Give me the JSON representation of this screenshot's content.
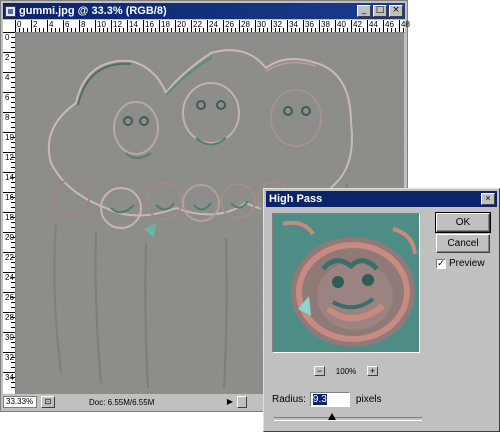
{
  "document_window": {
    "title": "gummi.jpg @ 33.3% (RGB/8)",
    "buttons": {
      "minimize": "_",
      "maximize": "□",
      "close": "×"
    },
    "ruler_h_labels": [
      "0",
      "2",
      "4",
      "6",
      "8",
      "10",
      "12",
      "14",
      "16",
      "18",
      "20",
      "22",
      "24",
      "26",
      "28",
      "30",
      "32",
      "34",
      "36",
      "38",
      "40",
      "42",
      "44",
      "46",
      "48"
    ],
    "ruler_v_labels": [
      "0",
      "2",
      "4",
      "6",
      "8",
      "10",
      "12",
      "14",
      "16",
      "18",
      "20",
      "22",
      "24",
      "26",
      "28",
      "30",
      "32",
      "34"
    ],
    "status": {
      "zoom": "33.33%",
      "doc_size": "Doc: 6.55M/6.55M",
      "arrow": "▶"
    }
  },
  "dialog": {
    "title": "High Pass",
    "close": "×",
    "ok_label": "OK",
    "cancel_label": "Cancel",
    "preview_label": "Preview",
    "preview_checked": true,
    "zoom_out": "−",
    "zoom_in": "+",
    "zoom_level": "100%",
    "radius_label": "Radius:",
    "radius_value": "9.3",
    "radius_unit": "pixels"
  },
  "colors": {
    "title_bar": "#0a246a",
    "chrome": "#c0c0c0",
    "canvas_gray": "#8b8b88",
    "preview_teal": "#4e8d86",
    "preview_pink": "#c98a82"
  }
}
